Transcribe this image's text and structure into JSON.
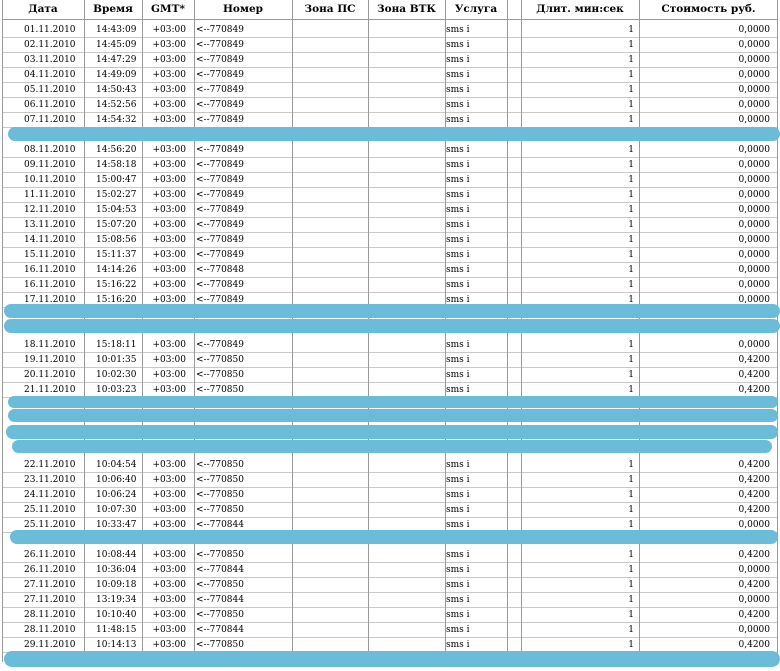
{
  "headers": [
    "Дата",
    "Время",
    "GMT*",
    "Номер",
    "Зона ПС",
    "Зона ВТК",
    "Услуга",
    "",
    "Длит. мин:сек",
    "Стоимость руб."
  ],
  "blocks": [
    {
      "rows": [
        [
          "01.11.2010",
          "14:43:09",
          "+03:00",
          "<--770849",
          "",
          "",
          "sms i",
          "",
          "1",
          "0,0000"
        ],
        [
          "02.11.2010",
          "14:45:09",
          "+03:00",
          "<--770849",
          "",
          "",
          "sms i",
          "",
          "1",
          "0,0000"
        ],
        [
          "03.11.2010",
          "14:47:29",
          "+03:00",
          "<--770849",
          "",
          "",
          "sms i",
          "",
          "1",
          "0,0000"
        ],
        [
          "04.11.2010",
          "14:49:09",
          "+03:00",
          "<--770849",
          "",
          "",
          "sms i",
          "",
          "1",
          "0,0000"
        ],
        [
          "05.11.2010",
          "14:50:43",
          "+03:00",
          "<--770849",
          "",
          "",
          "sms i",
          "",
          "1",
          "0,0000"
        ],
        [
          "06.11.2010",
          "14:52:56",
          "+03:00",
          "<--770849",
          "",
          "",
          "sms i",
          "",
          "1",
          "0,0000"
        ],
        [
          "07.11.2010",
          "14:54:32",
          "+03:00",
          "<--770849",
          "",
          "",
          "sms i",
          "",
          "1",
          "0,0000"
        ]
      ]
    },
    {
      "rows": [
        [
          "08.11.2010",
          "14:56:20",
          "+03:00",
          "<--770849",
          "",
          "",
          "sms i",
          "",
          "1",
          "0,0000"
        ],
        [
          "09.11.2010",
          "14:58:18",
          "+03:00",
          "<--770849",
          "",
          "",
          "sms i",
          "",
          "1",
          "0,0000"
        ],
        [
          "10.11.2010",
          "15:00:47",
          "+03:00",
          "<--770849",
          "",
          "",
          "sms i",
          "",
          "1",
          "0,0000"
        ],
        [
          "11.11.2010",
          "15:02:27",
          "+03:00",
          "<--770849",
          "",
          "",
          "sms i",
          "",
          "1",
          "0,0000"
        ],
        [
          "12.11.2010",
          "15:04:53",
          "+03:00",
          "<--770849",
          "",
          "",
          "sms i",
          "",
          "1",
          "0,0000"
        ],
        [
          "13.11.2010",
          "15:07:20",
          "+03:00",
          "<--770849",
          "",
          "",
          "sms i",
          "",
          "1",
          "0,0000"
        ],
        [
          "14.11.2010",
          "15:08:56",
          "+03:00",
          "<--770849",
          "",
          "",
          "sms i",
          "",
          "1",
          "0,0000"
        ],
        [
          "15.11.2010",
          "15:11:37",
          "+03:00",
          "<--770849",
          "",
          "",
          "sms i",
          "",
          "1",
          "0,0000"
        ],
        [
          "16.11.2010",
          "14:14:26",
          "+03:00",
          "<--770848",
          "",
          "",
          "sms i",
          "",
          "1",
          "0,0000"
        ],
        [
          "16.11.2010",
          "15:16:22",
          "+03:00",
          "<--770849",
          "",
          "",
          "sms i",
          "",
          "1",
          "0,0000"
        ],
        [
          "17.11.2010",
          "15:16:20",
          "+03:00",
          "<--770849",
          "",
          "",
          "sms i",
          "",
          "1",
          "0,0000"
        ]
      ]
    },
    {
      "rows": [
        [
          "18.11.2010",
          "15:18:11",
          "+03:00",
          "<--770849",
          "",
          "",
          "sms i",
          "",
          "1",
          "0,0000"
        ],
        [
          "19.11.2010",
          "10:01:35",
          "+03:00",
          "<--770850",
          "",
          "",
          "sms i",
          "",
          "1",
          "0,4200"
        ],
        [
          "20.11.2010",
          "10:02:30",
          "+03:00",
          "<--770850",
          "",
          "",
          "sms i",
          "",
          "1",
          "0,4200"
        ],
        [
          "21.11.2010",
          "10:03:23",
          "+03:00",
          "<--770850",
          "",
          "",
          "sms i",
          "",
          "1",
          "0,4200"
        ]
      ]
    },
    {
      "rows": [
        [
          "22.11.2010",
          "10:04:54",
          "+03:00",
          "<--770850",
          "",
          "",
          "sms i",
          "",
          "1",
          "0,4200"
        ],
        [
          "23.11.2010",
          "10:06:40",
          "+03:00",
          "<--770850",
          "",
          "",
          "sms i",
          "",
          "1",
          "0,4200"
        ],
        [
          "24.11.2010",
          "10:06:24",
          "+03:00",
          "<--770850",
          "",
          "",
          "sms i",
          "",
          "1",
          "0,4200"
        ],
        [
          "25.11.2010",
          "10:07:30",
          "+03:00",
          "<--770850",
          "",
          "",
          "sms i",
          "",
          "1",
          "0,4200"
        ],
        [
          "25.11.2010",
          "10:33:47",
          "+03:00",
          "<--770844",
          "",
          "",
          "sms i",
          "",
          "1",
          "0,0000"
        ]
      ]
    },
    {
      "rows": [
        [
          "26.11.2010",
          "10:08:44",
          "+03:00",
          "<--770850",
          "",
          "",
          "sms i",
          "",
          "1",
          "0,4200"
        ],
        [
          "26.11.2010",
          "10:36:04",
          "+03:00",
          "<--770844",
          "",
          "",
          "sms i",
          "",
          "1",
          "0,0000"
        ],
        [
          "27.11.2010",
          "10:09:18",
          "+03:00",
          "<--770850",
          "",
          "",
          "sms i",
          "",
          "1",
          "0,4200"
        ],
        [
          "27.11.2010",
          "13:19:34",
          "+03:00",
          "<--770844",
          "",
          "",
          "sms i",
          "",
          "1",
          "0,0000"
        ],
        [
          "28.11.2010",
          "10:10:40",
          "+03:00",
          "<--770850",
          "",
          "",
          "sms i",
          "",
          "1",
          "0,4200"
        ],
        [
          "28.11.2010",
          "11:48:15",
          "+03:00",
          "<--770844",
          "",
          "",
          "sms i",
          "",
          "1",
          "0,0000"
        ],
        [
          "29.11.2010",
          "10:14:13",
          "+03:00",
          "<--770850",
          "",
          "",
          "sms i",
          "",
          "1",
          "0,4200"
        ]
      ]
    }
  ],
  "colors": {
    "redaction": "#6bbcd8",
    "grid": "#9a9a9a"
  }
}
